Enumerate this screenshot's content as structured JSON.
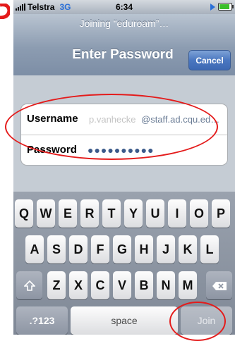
{
  "status_bar": {
    "carrier": "Telstra",
    "network": "3G",
    "time": "6:34"
  },
  "nav": {
    "prompt": "Joining “eduroam”…",
    "title": "Enter Password",
    "cancel_label": "Cancel"
  },
  "form": {
    "username_label": "Username",
    "username_placeholder": "p.vanhecke",
    "username_suffix": "@staff.ad.cqu.ed…",
    "password_label": "Password",
    "password_value": "●●●●●●●●●●"
  },
  "keyboard": {
    "row1": [
      "Q",
      "W",
      "E",
      "R",
      "T",
      "Y",
      "U",
      "I",
      "O",
      "P"
    ],
    "row2": [
      "A",
      "S",
      "D",
      "F",
      "G",
      "H",
      "J",
      "K",
      "L"
    ],
    "row3": [
      "Z",
      "X",
      "C",
      "V",
      "B",
      "N",
      "M"
    ],
    "num_label": ".?123",
    "space_label": "space",
    "join_label": "Join"
  },
  "colors": {
    "annotation": "#e41b1b",
    "nav_button": "#4a77c0"
  }
}
